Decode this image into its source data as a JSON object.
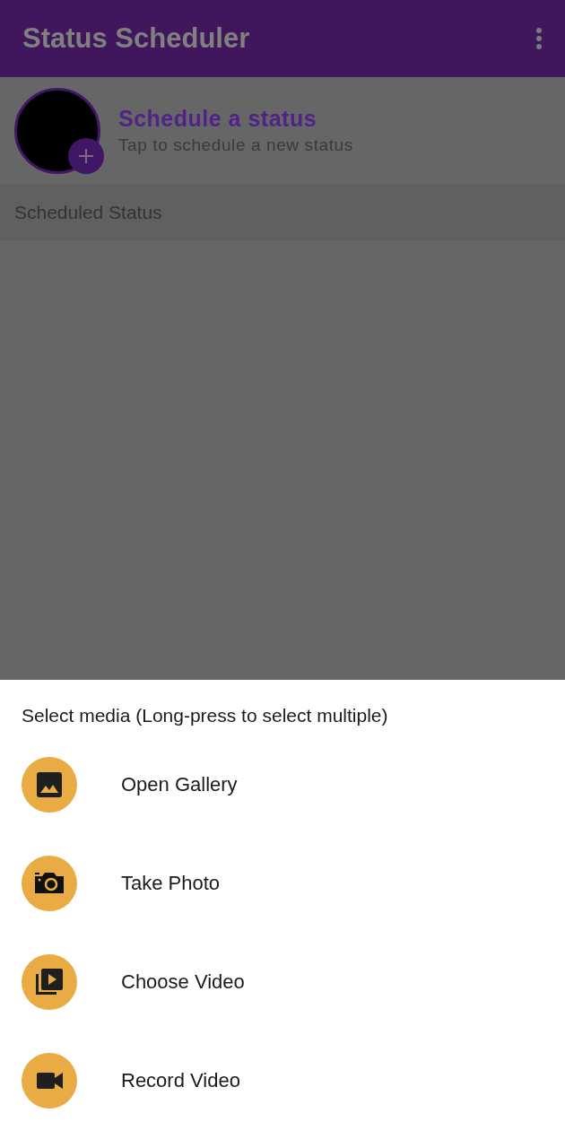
{
  "app_bar": {
    "title": "Status Scheduler"
  },
  "schedule_card": {
    "title": "Schedule a status",
    "subtitle": "Tap to schedule a new status"
  },
  "section_header": "Scheduled Status",
  "bottom_sheet": {
    "title": "Select media (Long-press to select multiple)",
    "options": [
      {
        "kind": "gallery",
        "label": "Open Gallery"
      },
      {
        "kind": "camera",
        "label": "Take Photo"
      },
      {
        "kind": "video-library",
        "label": "Choose Video"
      },
      {
        "kind": "videocam",
        "label": "Record Video"
      }
    ]
  }
}
